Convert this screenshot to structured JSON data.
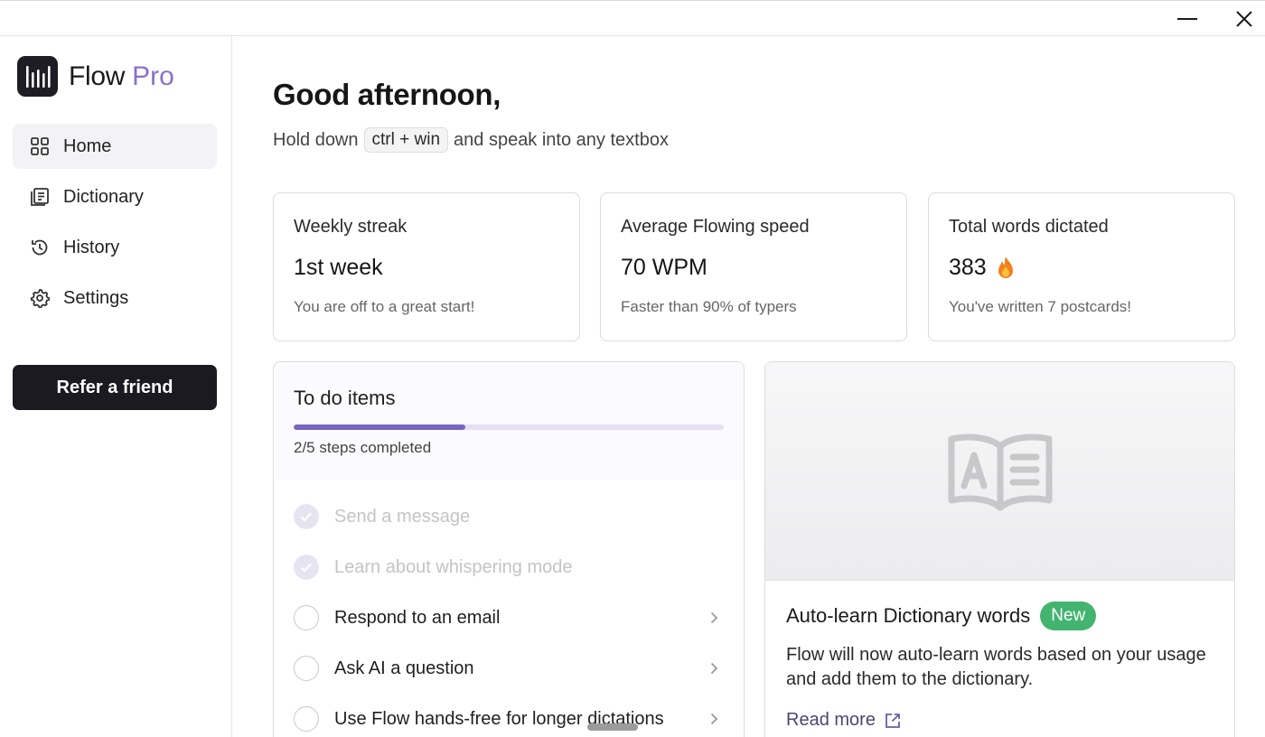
{
  "window": {
    "minimize_icon": "minimize-icon",
    "close_icon": "close-icon"
  },
  "brand": {
    "name": "Flow",
    "tier": "Pro"
  },
  "sidebar": {
    "items": [
      {
        "label": "Home",
        "icon": "grid-icon",
        "active": true
      },
      {
        "label": "Dictionary",
        "icon": "dictionary-icon",
        "active": false
      },
      {
        "label": "History",
        "icon": "history-icon",
        "active": false
      },
      {
        "label": "Settings",
        "icon": "gear-icon",
        "active": false
      }
    ],
    "refer_label": "Refer a friend"
  },
  "main": {
    "greeting": "Good afternoon,",
    "hint_before": "Hold down",
    "hint_key": "ctrl + win",
    "hint_after": "and speak into any textbox"
  },
  "stats": [
    {
      "title": "Weekly streak",
      "value": "1st week",
      "sub": "You are off to a great start!"
    },
    {
      "title": "Average Flowing speed",
      "value": "70 WPM",
      "sub": "Faster than 90% of typers"
    },
    {
      "title": "Total words dictated",
      "value": "383",
      "sub": "You've written 7 postcards!",
      "icon": "fire-icon"
    }
  ],
  "todo": {
    "title": "To do items",
    "progress_fraction": 0.4,
    "progress_text": "2/5 steps completed",
    "items": [
      {
        "label": "Send a message",
        "done": true
      },
      {
        "label": "Learn about whispering mode",
        "done": true
      },
      {
        "label": "Respond to an email",
        "done": false
      },
      {
        "label": "Ask AI a question",
        "done": false
      },
      {
        "label": "Use Flow hands-free for longer dictations",
        "done": false
      }
    ]
  },
  "feature": {
    "hero_icon": "book-icon",
    "title": "Auto-learn Dictionary words",
    "badge": "New",
    "description": "Flow will now auto-learn words based on your usage and add them to the dictionary.",
    "link": "Read more",
    "colors": {
      "badge": "#43b46f",
      "accent": "#7a64c2"
    }
  }
}
